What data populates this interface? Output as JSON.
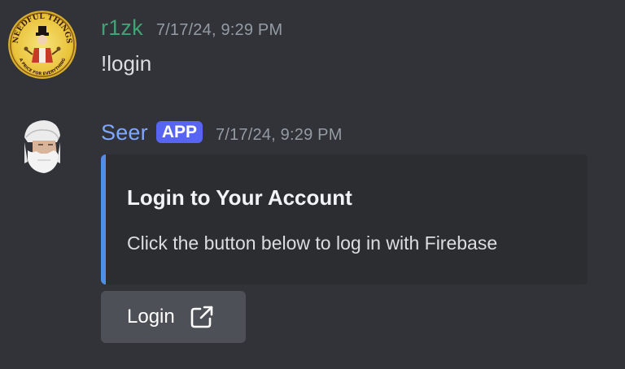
{
  "messages": [
    {
      "author": "r1zk",
      "author_color": "#43a275",
      "timestamp": "7/17/24, 9:29 PM",
      "content": "!login",
      "avatar": {
        "icon": "needful-things-avatar",
        "text_top": "NEEDFUL THINGS",
        "text_bottom": "A PRICE FOR EVERYTHING"
      }
    },
    {
      "author": "Seer",
      "author_color": "#7ea8ff",
      "badge": "APP",
      "timestamp": "7/17/24, 9:29 PM",
      "avatar": {
        "icon": "bearded-man-avatar"
      },
      "embed": {
        "accent_color": "#4f8fe6",
        "title": "Login to Your Account",
        "description": "Click the button below to log in with Firebase"
      },
      "button": {
        "label": "Login",
        "icon": "external-link-icon"
      }
    }
  ],
  "colors": {
    "background": "#313338",
    "embed_background": "#2b2d31",
    "badge": "#5865f2",
    "button": "#4e5058",
    "timestamp": "#949ba4"
  }
}
